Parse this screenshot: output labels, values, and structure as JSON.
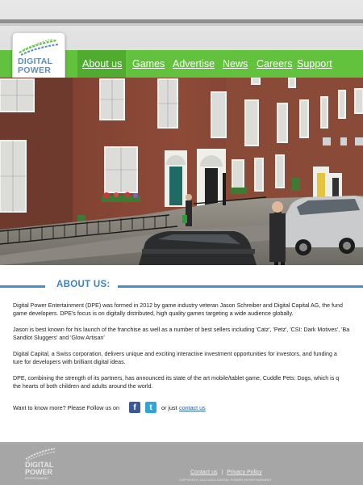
{
  "brand": {
    "name_line1": "DIGITAL",
    "name_line2": "POWER",
    "tagline": "ENTERTAINMENT",
    "accent_green": "#62c23d",
    "accent_blue": "#3a82c3"
  },
  "nav": {
    "items": [
      {
        "label": "About us"
      },
      {
        "label": "Games"
      },
      {
        "label": "Advertise"
      },
      {
        "label": "News"
      },
      {
        "label": "Careers"
      },
      {
        "label": "Support"
      }
    ]
  },
  "about": {
    "heading": "ABOUT US:",
    "p1": [
      "Digital Power Entertainment (DPE) was formed in 2012 by game industry veteran Jason Schreiber and Digital Capital AG, the fund",
      "game developers. DPE's focus is on digitally distributed, high quality games targeting a wide audience globally."
    ],
    "p2": [
      "Jason is best known for his launch of the franchise as well as a number of best sellers including 'Catz', 'Petz', 'CSI: Dark Motives', 'Ba",
      "Sandlot Sluggers' and 'Glow Artisan'"
    ],
    "p3": [
      "Digital Capital, a Swiss corporation, delivers unique and exciting interactive investment opportunities for investors, and funding a",
      "ture for developers with brilliant digital ideas."
    ],
    "p4": [
      "DPE, combining the strength of its partners, has announced its state of the art mobile/tablet game, Cuddle Pets: Dogs, which is q",
      "the hearts of both children and adults around the world."
    ],
    "follow_text": "Want to know more? Please Follow us on",
    "or_just": "or just",
    "contact_link": "contact us"
  },
  "social": {
    "facebook_icon": "facebook-icon",
    "twitter_icon": "twitter-icon",
    "facebook_glyph": "f",
    "twitter_glyph": "t"
  },
  "footer": {
    "logo_line1": "DIGITAL",
    "logo_line2": "POWER",
    "logo_tagline": "ENTERTAINMENT",
    "link_contact": "Contact us",
    "separator": "|",
    "link_privacy": "Privacy Policy",
    "copyright": "COPYRIGHT 2012-2013 DIGITAL POWER ENTERTAINMENT"
  }
}
